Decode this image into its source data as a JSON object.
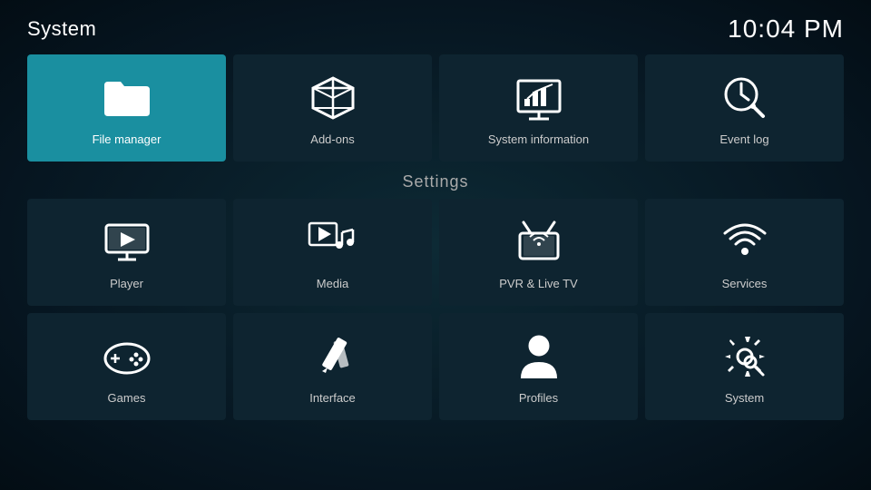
{
  "header": {
    "title": "System",
    "time": "10:04 PM"
  },
  "top_row": [
    {
      "id": "file-manager",
      "label": "File manager",
      "active": true
    },
    {
      "id": "add-ons",
      "label": "Add-ons",
      "active": false
    },
    {
      "id": "system-information",
      "label": "System information",
      "active": false
    },
    {
      "id": "event-log",
      "label": "Event log",
      "active": false
    }
  ],
  "settings_label": "Settings",
  "settings_row1": [
    {
      "id": "player",
      "label": "Player"
    },
    {
      "id": "media",
      "label": "Media"
    },
    {
      "id": "pvr-live-tv",
      "label": "PVR & Live TV"
    },
    {
      "id": "services",
      "label": "Services"
    }
  ],
  "settings_row2": [
    {
      "id": "games",
      "label": "Games"
    },
    {
      "id": "interface",
      "label": "Interface"
    },
    {
      "id": "profiles",
      "label": "Profiles"
    },
    {
      "id": "system",
      "label": "System"
    }
  ]
}
